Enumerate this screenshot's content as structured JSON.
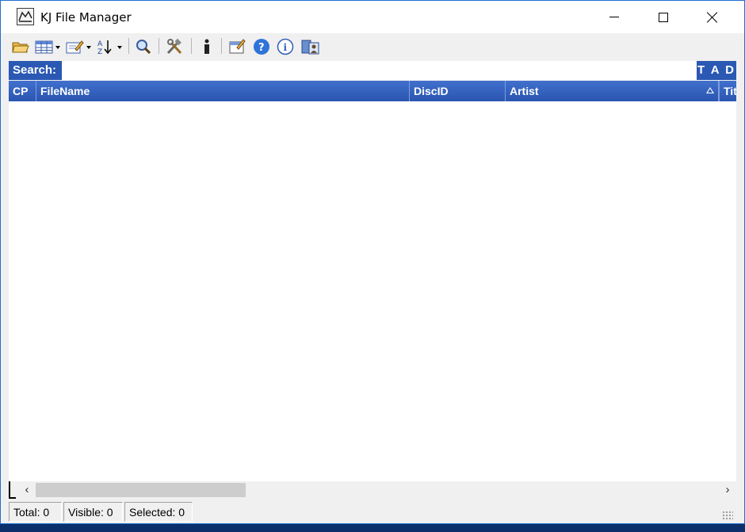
{
  "window": {
    "title": "KJ File Manager",
    "icon": "kj-app-icon"
  },
  "title_buttons": {
    "minimize_icon": "minimize-icon",
    "maximize_icon": "maximize-icon",
    "close_icon": "close-icon"
  },
  "toolbar": {
    "buttons": [
      {
        "icon": "open-folder-icon"
      },
      {
        "icon": "table-view-icon",
        "has_dropdown": true
      },
      {
        "icon": "edit-icon",
        "has_dropdown": true
      },
      {
        "icon": "sort-az-icon",
        "has_dropdown": true
      },
      {
        "icon": "search-magnifier-icon"
      },
      {
        "icon": "tools-icon"
      },
      {
        "icon": "info-i-icon"
      },
      {
        "icon": "properties-icon"
      },
      {
        "icon": "help-icon"
      },
      {
        "icon": "about-icon"
      },
      {
        "icon": "users-icon"
      }
    ]
  },
  "search": {
    "label": "Search:",
    "value": "",
    "mode_label": "T A D"
  },
  "columns": {
    "cp": "CP",
    "filename": "FileName",
    "discid": "DiscID",
    "artist": "Artist",
    "title_partial": "Tit"
  },
  "rows": [],
  "scrollbar": {
    "left_arrow": "‹",
    "right_arrow": "›"
  },
  "status": {
    "total": "Total: 0",
    "visible": "Visible: 0",
    "selected": "Selected: 0"
  },
  "colors": {
    "header_blue": "#2a58b3",
    "window_bg": "#f0f0f0"
  }
}
